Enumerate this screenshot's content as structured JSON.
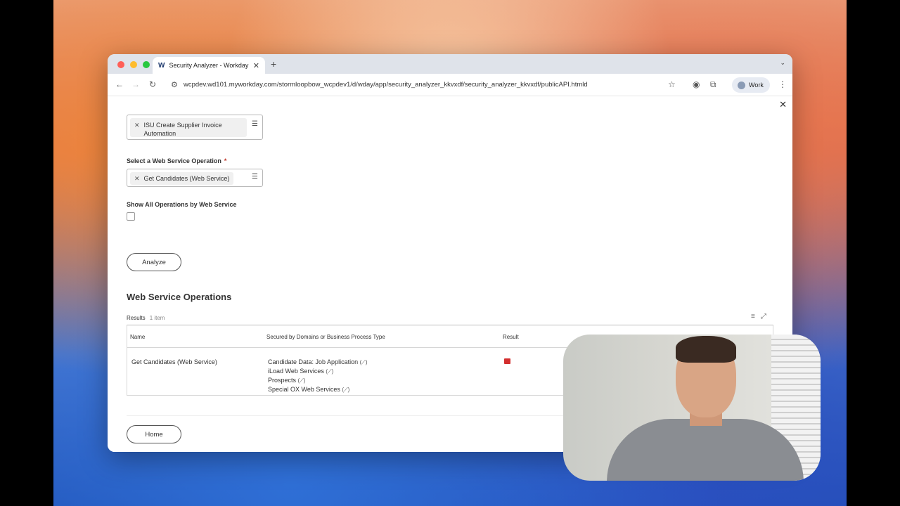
{
  "browser": {
    "tab_title": "Security Analyzer - Workday",
    "tab_favicon": "W",
    "url": "wcpdev.wd101.myworkday.com/stormloopbow_wcpdev1/d/wday/app/security_analyzer_kkvxdf/security_analyzer_kkvxdf/publicAPI.htmld",
    "profile_label": "Work"
  },
  "form": {
    "isu_value": [
      "ISU Create Supplier Invoice",
      "Automation"
    ],
    "web_service_operation_label": "Select a Web Service Operation",
    "required_marker": "*",
    "web_service_operation_value": "Get Candidates (Web Service)",
    "show_all_label": "Show All Operations by Web Service",
    "analyze_button": "Analyze"
  },
  "results_section": {
    "title": "Web Service Operations",
    "results_label": "Results",
    "results_count": "1 item",
    "columns": [
      "Name",
      "Secured by Domains or Business Process Type",
      "Result"
    ],
    "rows": [
      {
        "name": "Get Candidates (Web Service)",
        "domains": [
          "Candidate Data: Job Application",
          "iLoad Web Services",
          "Prospects",
          "Special OX Web Services"
        ],
        "result_color": "#d32f2f"
      }
    ]
  },
  "footer": {
    "home_button": "Home"
  }
}
